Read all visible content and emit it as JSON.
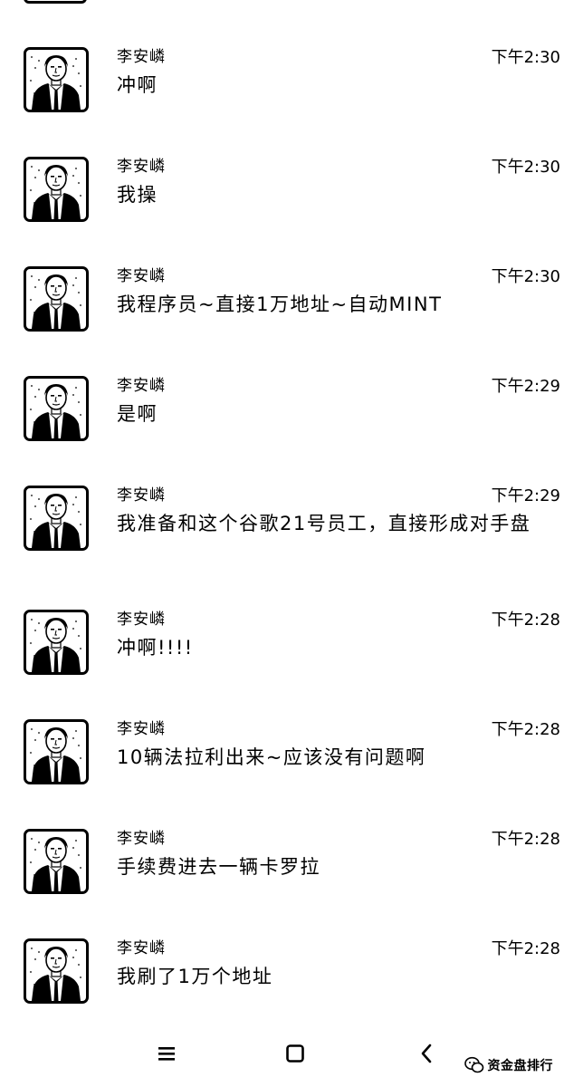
{
  "messages": [
    {
      "sender": "李安嶙",
      "time": "下午2:30",
      "text": "冲啊"
    },
    {
      "sender": "李安嶙",
      "time": "下午2:30",
      "text": "我操"
    },
    {
      "sender": "李安嶙",
      "time": "下午2:30",
      "text": "我程序员~直接1万地址~自动MINT"
    },
    {
      "sender": "李安嶙",
      "time": "下午2:29",
      "text": "是啊"
    },
    {
      "sender": "李安嶙",
      "time": "下午2:29",
      "text": "我准备和这个谷歌21号员工，直接形成对手盘"
    },
    {
      "sender": "李安嶙",
      "time": "下午2:28",
      "text": "冲啊!!!!"
    },
    {
      "sender": "李安嶙",
      "time": "下午2:28",
      "text": "10辆法拉利出来~应该没有问题啊"
    },
    {
      "sender": "李安嶙",
      "time": "下午2:28",
      "text": "手续费进去一辆卡罗拉"
    },
    {
      "sender": "李安嶙",
      "time": "下午2:28",
      "text": "我刷了1万个地址"
    }
  ],
  "navbar": {
    "menu_icon": "menu-icon",
    "home_icon": "square-home-icon",
    "back_icon": "chevron-left-back-icon"
  },
  "watermark": {
    "icon": "wechat-icon",
    "text": "资金盘排行"
  }
}
